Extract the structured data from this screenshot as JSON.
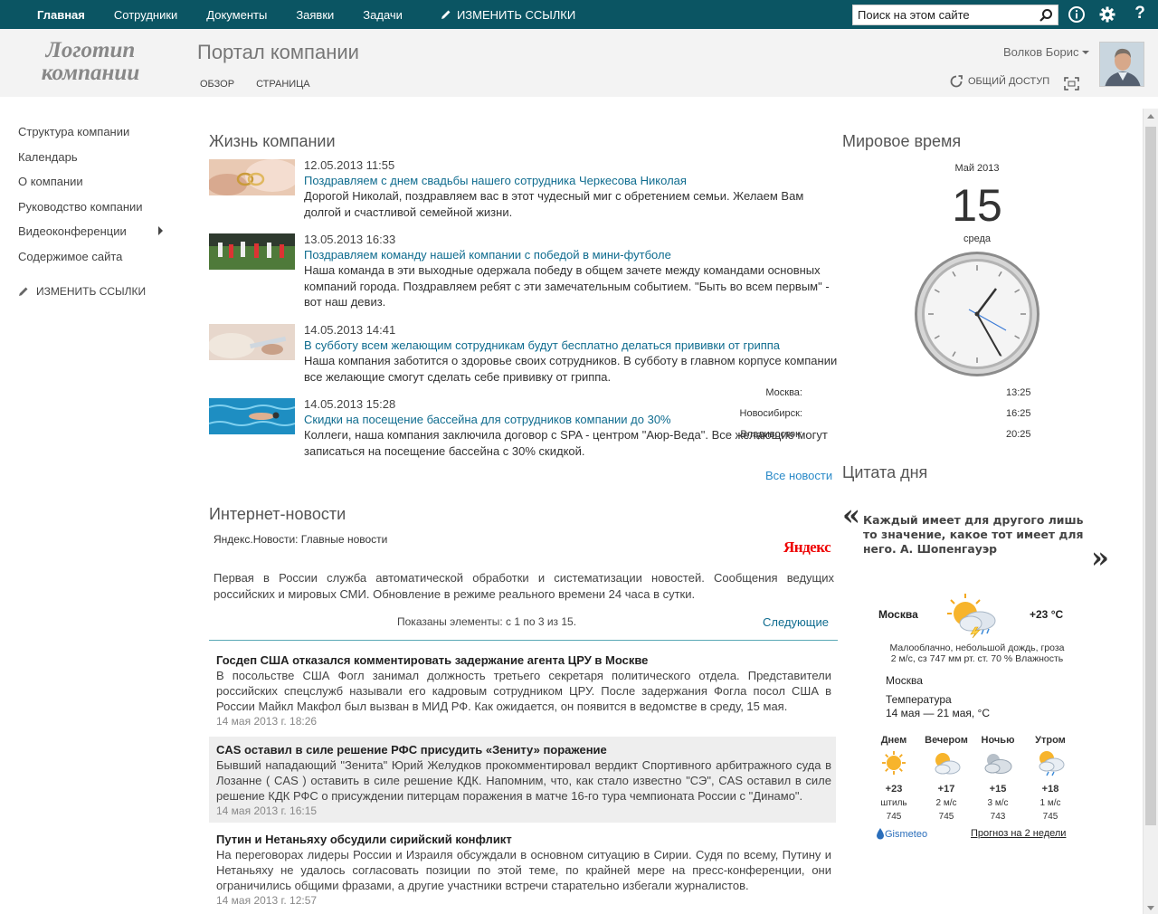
{
  "topbar": {
    "nav": [
      "Главная",
      "Сотрудники",
      "Документы",
      "Заявки",
      "Задачи"
    ],
    "edit_links": "ИЗМЕНИТЬ ССЫЛКИ",
    "search_placeholder": "Поиск на этом сайте",
    "icons": [
      "info-icon",
      "gear-icon",
      "help-icon"
    ],
    "help_label": "?"
  },
  "header": {
    "logo_line1": "Логотип",
    "logo_line2": "компании",
    "site_title": "Портал компании",
    "subnav": [
      "ОБЗОР",
      "СТРАНИЦА"
    ],
    "user_name": "Волков Борис",
    "share_label": "ОБЩИЙ ДОСТУП"
  },
  "leftnav": {
    "items": [
      "Структура компании",
      "Календарь",
      "О компании",
      "Руководство компании",
      "Видеоконференции",
      "Содержимое сайта"
    ],
    "edit_links": "ИЗМЕНИТЬ ССЫЛКИ"
  },
  "company_news": {
    "title": "Жизнь компании",
    "items": [
      {
        "date": "12.05.2013 11:55",
        "title": "Поздравляем с днем свадьбы нашего сотрудника Черкесова Николая",
        "body": "Дорогой Николай, поздравляем вас в этот чудесный миг с обретением семьи. Желаем Вам долгой и счастливой семейной жизни."
      },
      {
        "date": "13.05.2013 16:33",
        "title": "Поздравляем команду нашей компании с победой в мини-футболе",
        "body": "Наша команда в эти выходные одержала победу в общем зачете между командами основных компаний города. Поздравляем ребят с эти замечательным событием. \"Быть во всем первым\" - вот наш девиз."
      },
      {
        "date": "14.05.2013 14:41",
        "title": "В субботу всем желающим сотрудникам будут бесплатно делаться прививки от гриппа",
        "body": "Наша компания заботится о здоровье своих сотрудников. В субботу в главном корпусе компании все желающие смогут сделать себе прививку от гриппа."
      },
      {
        "date": "14.05.2013 15:28",
        "title": "Скидки на посещение бассейна для сотрудников компании до 30%",
        "body": "Коллеги, наша компания заключила договор с SPA - центром \"Аюр-Веда\". Все желающие могут записаться на посещение бассейна с 30% скидкой."
      }
    ],
    "all_news": "Все новости"
  },
  "internet_news": {
    "title": "Интернет-новости",
    "feed_name": "Яндекс.Новости: Главные новости",
    "brand": "Яндекс",
    "description": "Первая в России служба автоматической обработки и систематизации новостей. Сообщения ведущих российских и мировых СМИ. Обновление в режиме реального времени 24 часа в сутки.",
    "pager_text": "Показаны элементы: с 1 по 3 из 15.",
    "next": "Следующие",
    "items": [
      {
        "title": "Госдеп США отказался комментировать задержание агента ЦРУ в Москве",
        "body": "В посольстве США Фогл занимал должность третьего секретаря политического отдела. Представители российских спецслужб называли его кадровым сотрудником ЦРУ. После задержания Фогла посол США в России Майкл Макфол был вызван в МИД РФ. Как ожидается, он появится в ведомстве в среду, 15 мая.",
        "date": "14 мая 2013 г. 18:26"
      },
      {
        "title": "CAS оставил в силе решение РФС присудить «Зениту» поражение",
        "body": "Бывший нападающий \"Зенита\" Юрий Желудков прокомментировал вердикт Спортивного арбитражного суда в Лозанне ( CAS ) оставить в силе решение КДК. Напомним, что, как стало известно \"СЭ\", CAS оставил в силе решение КДК РФС о присуждении питерцам поражения в матче 16-го тура чемпионата России с \"Динамо\".",
        "date": "14 мая 2013 г. 16:15"
      },
      {
        "title": "Путин и Нетаньяху обсудили сирийский конфликт",
        "body": "На переговорах лидеры России и Израиля обсуждали в основном ситуацию в Сирии. Судя по всему, Путину и Нетаньяху не удалось согласовать позиции по этой теме, по крайней мере на пресс-конференции, они ограничились общими фразами, а другие участники встречи старательно избегали журналистов.",
        "date": "14 мая 2013 г. 12:57"
      }
    ]
  },
  "world_time": {
    "title": "Мировое время",
    "month": "Май 2013",
    "day": "15",
    "weekday": "среда",
    "cities": [
      {
        "name": "Москва:",
        "time": "13:25"
      },
      {
        "name": "Новосибирск:",
        "time": "16:25"
      },
      {
        "name": "Владивосток:",
        "time": "20:25"
      }
    ]
  },
  "quote": {
    "title": "Цитата дня",
    "open_mark": "«",
    "close_mark": "»",
    "text": "Каждый имеет для другого лишь то значение, какое тот имеет для него. А. Шопенгауэр"
  },
  "weather": {
    "city": "Москва",
    "temp": "+23 °C",
    "desc_line1": "Малооблачно, небольшой дождь, гроза",
    "desc_line2": "2 м/с, сз   747 мм рт. ст.   70 % Влажность",
    "city2": "Москва",
    "range_label": "Температура",
    "range": "14 мая — 21 мая, °C",
    "forecast": [
      {
        "period": "Днем",
        "temp": "+23",
        "wind": "штиль",
        "pressure": "745",
        "icon": "sun-icon"
      },
      {
        "period": "Вечером",
        "temp": "+17",
        "wind": "2 м/с",
        "pressure": "745",
        "icon": "sun-cloud-icon"
      },
      {
        "period": "Ночью",
        "temp": "+15",
        "wind": "3 м/с",
        "pressure": "743",
        "icon": "cloud-icon"
      },
      {
        "period": "Утром",
        "temp": "+18",
        "wind": "1 м/с",
        "pressure": "745",
        "icon": "sun-cloud-rain-icon"
      }
    ],
    "provider": "Gismeteo",
    "two_weeks": "Прогноз на 2 недели"
  },
  "colors": {
    "topbar": "#0b5563",
    "link": "#0f6c8f",
    "accent_link": "#2a8ac8"
  }
}
